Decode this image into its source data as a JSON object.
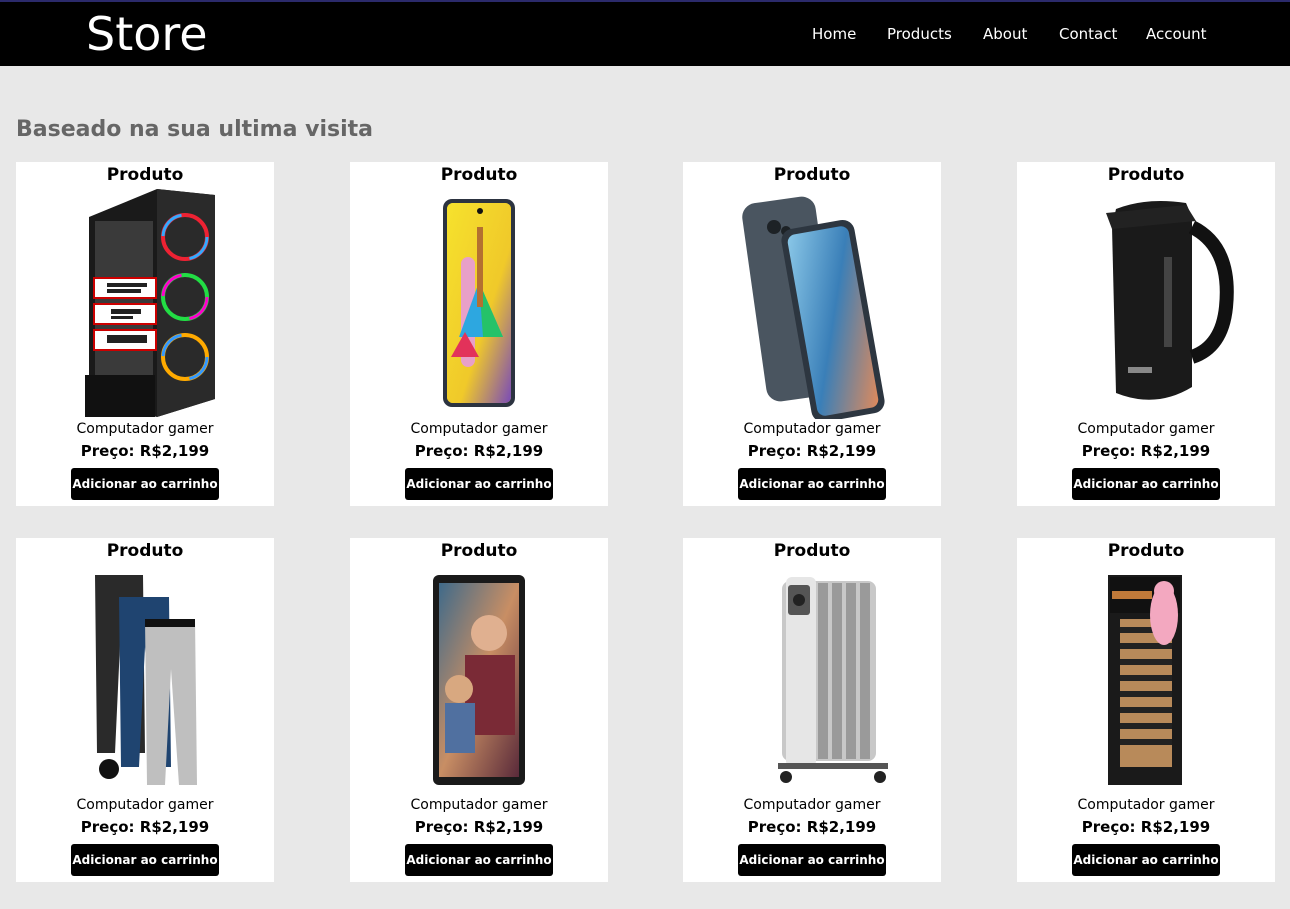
{
  "header": {
    "logo": "Store",
    "nav": [
      "Home",
      "Products",
      "About",
      "Contact",
      "Account"
    ]
  },
  "section": {
    "title": "Baseado na sua ultima visita"
  },
  "products": [
    {
      "title": "Produto",
      "name": "Computador gamer",
      "price_label": "Preço:",
      "price": "R$2,199",
      "button": "Adicionar ao carrinho",
      "image": "gaming-pc-tower"
    },
    {
      "title": "Produto",
      "name": "Computador gamer",
      "price_label": "Preço:",
      "price": "R$2,199",
      "button": "Adicionar ao carrinho",
      "image": "smartphone-yellow"
    },
    {
      "title": "Produto",
      "name": "Computador gamer",
      "price_label": "Preço:",
      "price": "R$2,199",
      "button": "Adicionar ao carrinho",
      "image": "smartphone-blue"
    },
    {
      "title": "Produto",
      "name": "Computador gamer",
      "price_label": "Preço:",
      "price": "R$2,199",
      "button": "Adicionar ao carrinho",
      "image": "electric-kettle"
    },
    {
      "title": "Produto",
      "name": "Computador gamer",
      "price_label": "Preço:",
      "price": "R$2,199",
      "button": "Adicionar ao carrinho",
      "image": "jogger-pants"
    },
    {
      "title": "Produto",
      "name": "Computador gamer",
      "price_label": "Preço:",
      "price": "R$2,199",
      "button": "Adicionar ao carrinho",
      "image": "tablet"
    },
    {
      "title": "Produto",
      "name": "Computador gamer",
      "price_label": "Preço:",
      "price": "R$2,199",
      "button": "Adicionar ao carrinho",
      "image": "oil-heater"
    },
    {
      "title": "Produto",
      "name": "Computador gamer",
      "price_label": "Preço:",
      "price": "R$2,199",
      "button": "Adicionar ao carrinho",
      "image": "battery-pack"
    }
  ],
  "colors": {
    "header_bg": "#000000",
    "page_bg": "#e8e8e8",
    "section_title": "#666666",
    "button_bg": "#000000"
  }
}
